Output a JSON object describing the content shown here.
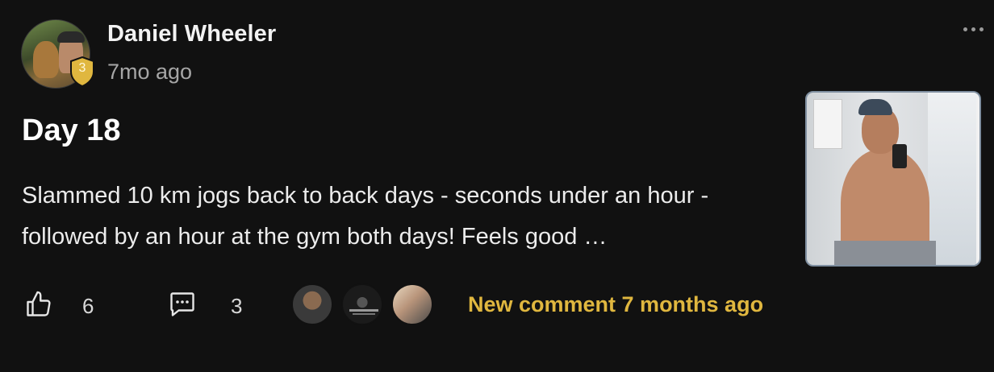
{
  "post": {
    "author": {
      "name": "Daniel Wheeler",
      "level": "3",
      "posted_ago": "7mo ago"
    },
    "title": "Day 18",
    "body": "Slammed 10 km jogs back to back days - seconds under an hour - followed by an hour at the gym both days! Feels good …",
    "actions": {
      "likes": "6",
      "comments": "3",
      "new_comment_label": "New comment 7 months ago"
    },
    "icons": {
      "like": "thumbs-up-icon",
      "comment": "comment-bubble-icon",
      "more": "more-dots-icon"
    },
    "colors": {
      "background": "#111111",
      "accent": "#e0b73f",
      "badge": "#e0b73f"
    }
  }
}
